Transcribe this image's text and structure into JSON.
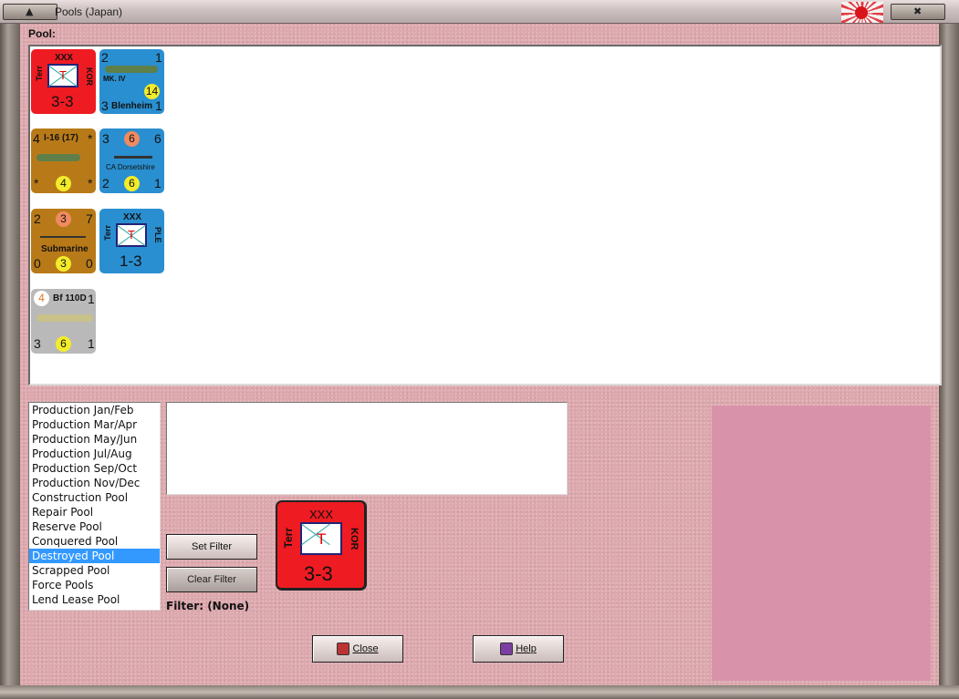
{
  "window": {
    "title": "Pools (Japan)"
  },
  "pool_label": "Pool:",
  "counters": [
    {
      "kind": "land",
      "color": "#ee1b22",
      "size": "XXX",
      "type": "Terr",
      "home": "KOR",
      "symbol": "T",
      "strength": "3-3"
    },
    {
      "kind": "air",
      "color": "#2a8fd0",
      "tl": "2",
      "tr": "1",
      "mark": "MK. IV",
      "badge": "14",
      "bl": "3",
      "name": "Blenheim",
      "br": "1"
    },
    {
      "kind": "air",
      "color": "#b87a18",
      "tl": "4",
      "name": "I-16 (17)",
      "tr": "*",
      "bl": "*",
      "badge": "4",
      "br": "*"
    },
    {
      "kind": "ship",
      "color": "#2a8fd0",
      "tl": "3",
      "top_badge": "6",
      "tr": "6",
      "name": "CA Dorsetshire",
      "bl": "2",
      "badge": "6",
      "br": "1"
    },
    {
      "kind": "sub",
      "color": "#b87a18",
      "tl": "2",
      "top_badge": "3",
      "tr": "7",
      "name": "Submarine",
      "bl": "0",
      "badge": "3",
      "br": "0"
    },
    {
      "kind": "land",
      "color": "#2a8fd0",
      "size": "XXX",
      "type": "Terr",
      "home": "PLE",
      "symbol": "T",
      "strength": "1-3"
    },
    {
      "kind": "air",
      "color": "#b9b9b9",
      "tl": "4",
      "name": "Bf 110D",
      "tr": "1",
      "bl": "3",
      "badge": "6",
      "br": "1"
    }
  ],
  "pool_list": [
    "Production Jan/Feb",
    "Production Mar/Apr",
    "Production May/Jun",
    "Production Jul/Aug",
    "Production Sep/Oct",
    "Production Nov/Dec",
    "Construction Pool",
    "Repair Pool",
    "Reserve Pool",
    "Conquered Pool",
    "Destroyed Pool",
    "Scrapped Pool",
    "Force Pools",
    "Lend Lease Pool"
  ],
  "selected_pool": "Destroyed Pool",
  "buttons": {
    "set_filter": "Set Filter",
    "clear_filter": "Clear Filter",
    "close": "Close",
    "help": "Help"
  },
  "filter_text": "Filter: (None)",
  "preview_counter": {
    "size": "XXX",
    "type": "Terr",
    "home": "KOR",
    "symbol": "T",
    "strength": "3-3"
  },
  "icons": {
    "close_icon": "door-exit-icon",
    "help_icon": "book-icon",
    "flag": "rising-sun-flag-icon"
  }
}
